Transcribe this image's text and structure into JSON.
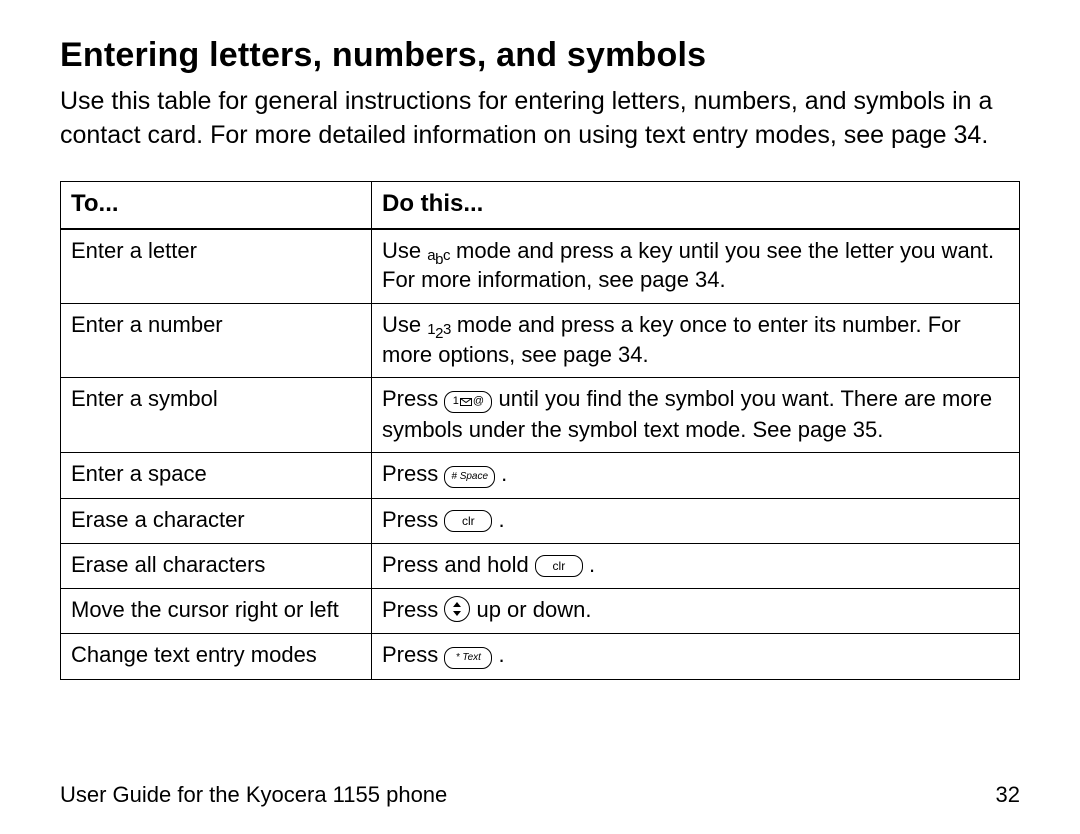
{
  "heading": "Entering letters, numbers, and symbols",
  "intro": "Use this table for general instructions for entering letters, numbers, and symbols in a contact card. For more detailed information on using text entry modes, see page 34.",
  "headers": {
    "col1": "To...",
    "col2": "Do this..."
  },
  "rows": {
    "r0": {
      "to": "Enter a letter",
      "pre": "Use ",
      "mode": {
        "a": "a",
        "b": "b",
        "c": "c"
      },
      "post": " mode and press a key until you see the letter you want. For more information, see page 34."
    },
    "r1": {
      "to": "Enter a number",
      "pre": "Use ",
      "mode": {
        "a": "1",
        "b": "2",
        "c": "3"
      },
      "post": " mode and press a key once to enter its number. For more options, see page 34."
    },
    "r2": {
      "to": "Enter a symbol",
      "pre": "Press ",
      "keyPrefix": "1",
      "keySuffix": "@",
      "post": " until you find the symbol you want. There are more symbols under the symbol text mode. See page 35."
    },
    "r3": {
      "to": "Enter a space",
      "pre": "Press ",
      "keyLabel": "# Space",
      "post": " ."
    },
    "r4": {
      "to": "Erase a character",
      "pre": "Press ",
      "keyLabel": "clr",
      "post": " ."
    },
    "r5": {
      "to": "Erase all characters",
      "pre": "Press and hold ",
      "keyLabel": "clr",
      "post": " ."
    },
    "r6": {
      "to": "Move the cursor right or left",
      "pre": "Press ",
      "post": " up or down."
    },
    "r7": {
      "to": "Change text entry modes",
      "pre": "Press ",
      "keyLabel": "* Text",
      "post": " ."
    }
  },
  "footer": {
    "left": "User Guide for the Kyocera 1155 phone",
    "right": "32"
  }
}
